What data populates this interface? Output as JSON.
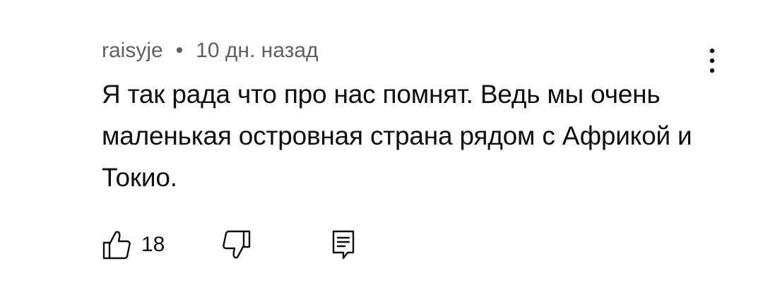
{
  "comment": {
    "author": "raisyje",
    "separator": "•",
    "time": "10 дн. назад",
    "text": "Я так рада что про нас помнят. Ведь мы очень маленькая островная страна рядом с Африкой и Токио.",
    "likes": "18"
  },
  "icons": {
    "more": "more-vert-icon",
    "like": "thumb-up-icon",
    "dislike": "thumb-down-icon",
    "reply": "reply-comment-icon"
  },
  "colors": {
    "text": "#0f0f0f",
    "meta": "#606060",
    "background": "#ffffff"
  }
}
